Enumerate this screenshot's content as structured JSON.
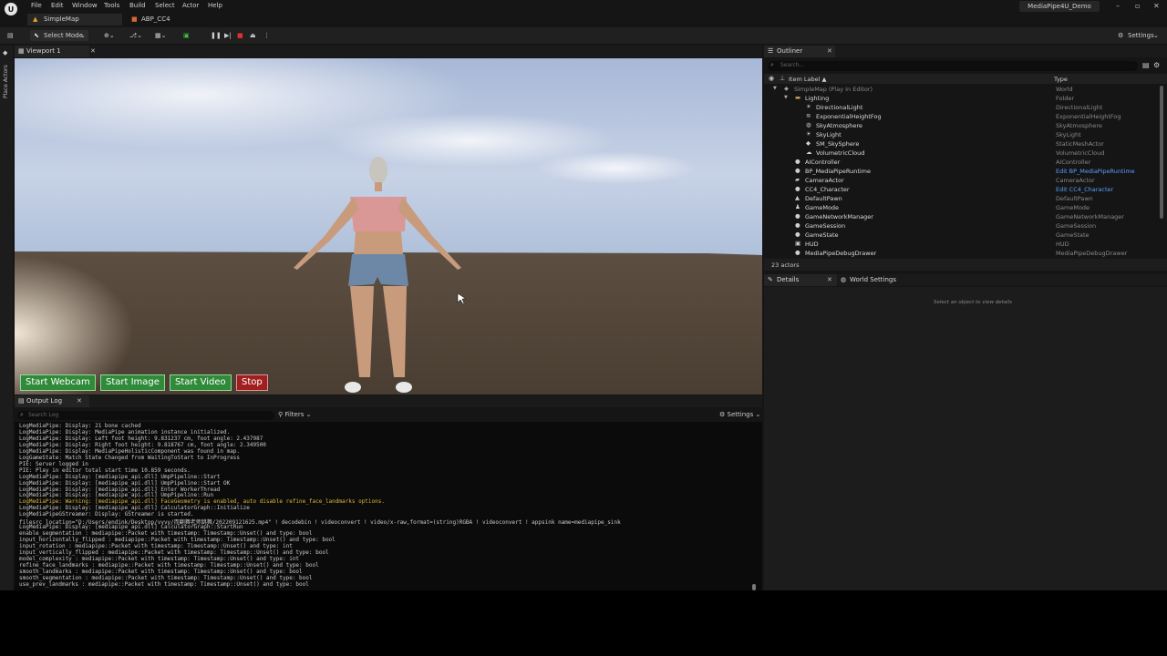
{
  "menu": [
    "File",
    "Edit",
    "Window",
    "Tools",
    "Build",
    "Select",
    "Actor",
    "Help"
  ],
  "window_title": "MediaPipe4U_Demo",
  "window_controls": [
    "–",
    "▫",
    "✕"
  ],
  "tabs": [
    {
      "label": "SimpleMap"
    },
    {
      "label": "ABP_CC4"
    }
  ],
  "toolbar": {
    "select_mode": "Select Mode",
    "settings": "Settings"
  },
  "left_strip_label": "Place Actors",
  "viewport": {
    "tab_label": "Viewport 1",
    "buttons": [
      {
        "label": "Start Webcam",
        "color": "#2f8a3a"
      },
      {
        "label": "Start Image",
        "color": "#2f8a3a"
      },
      {
        "label": "Start Video",
        "color": "#2f8a3a"
      },
      {
        "label": "Stop",
        "color": "#a11f1f"
      }
    ]
  },
  "output_log": {
    "tab_label": "Output Log",
    "search_placeholder": "Search Log",
    "filters": "Filters",
    "settings": "Settings",
    "lines": [
      {
        "text": "LogMediaPipe: Display: 21 bone cached",
        "warn": false
      },
      {
        "text": "LogMediaPipe: Display: MediaPipe animation instance initialized.",
        "warn": false
      },
      {
        "text": "LogMediaPipe: Display: Left foot height: 9.831237 cm, foot angle: 2.437987",
        "warn": false
      },
      {
        "text": "LogMediaPipe: Display: Right foot height: 9.818767 cm, foot angle: 2.349500",
        "warn": false
      },
      {
        "text": "LogMediaPipe: Display: MediaPipeHolisticComponent was found in map.",
        "warn": false
      },
      {
        "text": "LogGameState: Match State Changed from WaitingToStart to InProgress",
        "warn": false
      },
      {
        "text": "PIE: Server logged in",
        "warn": false
      },
      {
        "text": "PIE: Play in editor total start time 10.859 seconds.",
        "warn": false
      },
      {
        "text": "LogMediaPipe: Display: [mediapipe_api.dll] UmpPipeline::Start",
        "warn": false
      },
      {
        "text": "LogMediaPipe: Display: [mediapipe_api.dll] UmpPipeline::Start OK",
        "warn": false
      },
      {
        "text": "LogMediaPipe: Display: [mediapipe_api.dll] Enter WorkerThread",
        "warn": false
      },
      {
        "text": "LogMediaPipe: Display: [mediapipe_api.dll] UmpPipeline::Run",
        "warn": false
      },
      {
        "text": "LogMediaPipe: Warning: [mediapipe_api.dll] FaceGeometry is enabled, auto disable refine_face_landmarks options.",
        "warn": true
      },
      {
        "text": "LogMediaPipe: Display: [mediapipe_api.dll] CalculatorGraph::Initialize",
        "warn": false
      },
      {
        "text": "LogMediaPipeGStreamer: Display: GStreamer is started.",
        "warn": false
      },
      {
        "text": "filesrc location=\"D:/Users/endink/Desktop/vvvv/而翻舞老师跳舞/202209121625.mp4\" ! decodebin ! videoconvert ! video/x-raw,format=(string)RGBA ! videoconvert ! appsink name=mediapipe_sink",
        "warn": false
      },
      {
        "text": "LogMediaPipe: Display: [mediapipe_api.dll] CalculatorGraph::StartRun",
        "warn": false
      },
      {
        "text": "enable_segmentation : mediapipe::Packet with timestamp: Timestamp::Unset() and type: bool",
        "warn": false
      },
      {
        "text": "input_horizontally_flipped : mediapipe::Packet with timestamp: Timestamp::Unset() and type: bool",
        "warn": false
      },
      {
        "text": "input_rotation : mediapipe::Packet with timestamp: Timestamp::Unset() and type: int",
        "warn": false
      },
      {
        "text": "input_vertically_flipped : mediapipe::Packet with timestamp: Timestamp::Unset() and type: bool",
        "warn": false
      },
      {
        "text": "model_complexity : mediapipe::Packet with timestamp: Timestamp::Unset() and type: int",
        "warn": false
      },
      {
        "text": "refine_face_landmarks : mediapipe::Packet with timestamp: Timestamp::Unset() and type: bool",
        "warn": false
      },
      {
        "text": "smooth_landmarks : mediapipe::Packet with timestamp: Timestamp::Unset() and type: bool",
        "warn": false
      },
      {
        "text": "smooth_segmentation : mediapipe::Packet with timestamp: Timestamp::Unset() and type: bool",
        "warn": false
      },
      {
        "text": "use_prev_landmarks : mediapipe::Packet with timestamp: Timestamp::Unset() and type: bool",
        "warn": false
      }
    ]
  },
  "outliner": {
    "tab_label": "Outliner",
    "search_placeholder": "Search...",
    "col_label": "Item Label ▲",
    "col_type": "Type",
    "rows": [
      {
        "label": "SimpleMap (Play In Editor)",
        "type": "World",
        "depth": 0,
        "icon": "world-icon",
        "link": false,
        "dim": true
      },
      {
        "label": "Lighting",
        "type": "Folder",
        "depth": 1,
        "icon": "folder-icon",
        "link": false,
        "dim": false
      },
      {
        "label": "DirectionalLight",
        "type": "DirectionalLight",
        "depth": 2,
        "icon": "light-icon",
        "link": false,
        "dim": false
      },
      {
        "label": "ExponentialHeightFog",
        "type": "ExponentialHeightFog",
        "depth": 2,
        "icon": "fog-icon",
        "link": false,
        "dim": false
      },
      {
        "label": "SkyAtmosphere",
        "type": "SkyAtmosphere",
        "depth": 2,
        "icon": "sky-icon",
        "link": false,
        "dim": false
      },
      {
        "label": "SkyLight",
        "type": "SkyLight",
        "depth": 2,
        "icon": "light-icon",
        "link": false,
        "dim": false
      },
      {
        "label": "SM_SkySphere",
        "type": "StaticMeshActor",
        "depth": 2,
        "icon": "mesh-icon",
        "link": false,
        "dim": false
      },
      {
        "label": "VolumetricCloud",
        "type": "VolumetricCloud",
        "depth": 2,
        "icon": "cloud-icon",
        "link": false,
        "dim": false
      },
      {
        "label": "AIController",
        "type": "AIController",
        "depth": 1,
        "icon": "actor-icon",
        "link": false,
        "dim": false
      },
      {
        "label": "BP_MediaPipeRuntime",
        "type": "Edit BP_MediaPipeRuntime",
        "depth": 1,
        "icon": "actor-icon",
        "link": true,
        "dim": false
      },
      {
        "label": "CameraActor",
        "type": "CameraActor",
        "depth": 1,
        "icon": "camera-icon",
        "link": false,
        "dim": false
      },
      {
        "label": "CC4_Character",
        "type": "Edit CC4_Character",
        "depth": 1,
        "icon": "actor-icon",
        "link": true,
        "dim": false
      },
      {
        "label": "DefaultPawn",
        "type": "DefaultPawn",
        "depth": 1,
        "icon": "pawn-icon",
        "link": false,
        "dim": false
      },
      {
        "label": "GameMode",
        "type": "GameMode",
        "depth": 1,
        "icon": "gamemode-icon",
        "link": false,
        "dim": false
      },
      {
        "label": "GameNetworkManager",
        "type": "GameNetworkManager",
        "depth": 1,
        "icon": "actor-icon",
        "link": false,
        "dim": false
      },
      {
        "label": "GameSession",
        "type": "GameSession",
        "depth": 1,
        "icon": "actor-icon",
        "link": false,
        "dim": false
      },
      {
        "label": "GameState",
        "type": "GameState",
        "depth": 1,
        "icon": "actor-icon",
        "link": false,
        "dim": false
      },
      {
        "label": "HUD",
        "type": "HUD",
        "depth": 1,
        "icon": "hud-icon",
        "link": false,
        "dim": false
      },
      {
        "label": "MediaPipeDebugDrawer",
        "type": "MediaPipeDebugDrawer",
        "depth": 1,
        "icon": "actor-icon",
        "link": false,
        "dim": false
      }
    ],
    "actor_count": "23 actors"
  },
  "details": {
    "tab_label": "Details",
    "world_settings_label": "World Settings",
    "empty_message": "Select an object to view details"
  }
}
